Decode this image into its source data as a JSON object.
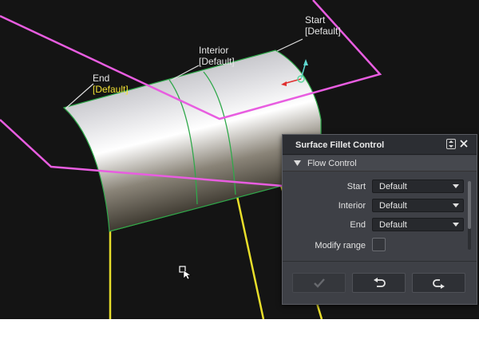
{
  "viewport": {
    "callouts": {
      "start": {
        "name": "Start",
        "value": "[Default]"
      },
      "interior": {
        "name": "Interior",
        "value": "[Default]"
      },
      "end": {
        "name": "End",
        "value": "[Default]"
      }
    }
  },
  "panel": {
    "title": "Surface Fillet Control",
    "section": "Flow Control",
    "rows": {
      "start": {
        "label": "Start",
        "value": "Default"
      },
      "interior": {
        "label": "Interior",
        "value": "Default"
      },
      "end": {
        "label": "End",
        "value": "Default"
      }
    },
    "modify_range": {
      "label": "Modify range",
      "checked": false
    },
    "buttons": {
      "apply": {
        "icon": "checkmark-icon",
        "enabled": false
      },
      "undo": {
        "icon": "undo-icon"
      },
      "redo": {
        "icon": "redo-icon"
      }
    }
  },
  "colors": {
    "viewport_bg": "#141414",
    "plane_outline": "#e85de0",
    "yellow_edges": "#e8de2a",
    "iso_lines": "#2fa84a",
    "active_callout": "#f2e233"
  }
}
